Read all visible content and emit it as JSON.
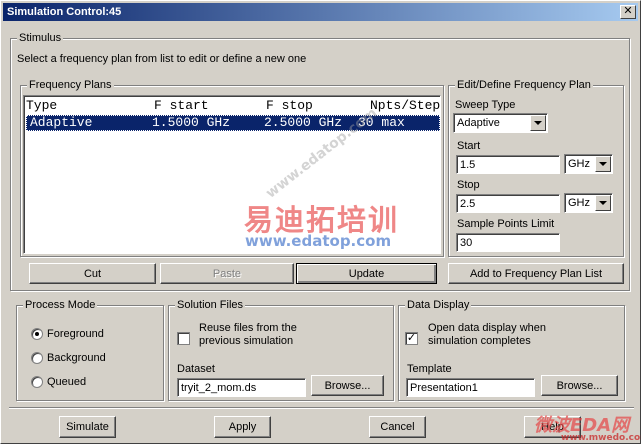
{
  "window": {
    "title": "Simulation Control:45"
  },
  "stimulus": {
    "group_label": "Stimulus",
    "instruction": "Select a frequency plan from list to edit or define a new one"
  },
  "frequency_plans": {
    "group_label": "Frequency Plans",
    "columns": [
      "Type",
      "F start",
      "F stop",
      "Npts/Step"
    ],
    "rows": [
      {
        "type": "Adaptive",
        "fstart": "1.5000 GHz",
        "fstop": "2.5000 GHz",
        "npts": "30 max"
      }
    ],
    "buttons": {
      "cut": "Cut",
      "paste": "Paste",
      "update": "Update"
    }
  },
  "edit_plan": {
    "group_label": "Edit/Define Frequency Plan",
    "sweep_type_label": "Sweep Type",
    "sweep_type_value": "Adaptive",
    "start_label": "Start",
    "start_value": "1.5",
    "start_unit": "GHz",
    "stop_label": "Stop",
    "stop_value": "2.5",
    "stop_unit": "GHz",
    "sample_points_label": "Sample Points Limit",
    "sample_points_value": "30",
    "add_button": "Add to Frequency Plan List"
  },
  "process_mode": {
    "group_label": "Process Mode",
    "options": [
      "Foreground",
      "Background",
      "Queued"
    ],
    "selected": "Foreground"
  },
  "solution_files": {
    "group_label": "Solution Files",
    "reuse_label_line1": "Reuse files from the",
    "reuse_label_line2": "previous simulation",
    "reuse_checked": false,
    "dataset_label": "Dataset",
    "dataset_value": "tryit_2_mom.ds",
    "browse_button": "Browse..."
  },
  "data_display": {
    "group_label": "Data Display",
    "open_label_line1": "Open data display when",
    "open_label_line2": "simulation completes",
    "open_checked": true,
    "template_label": "Template",
    "template_value": "Presentation1",
    "browse_button": "Browse..."
  },
  "footer": {
    "simulate": "Simulate",
    "apply": "Apply",
    "cancel": "Cancel",
    "help": "Help"
  },
  "watermarks": {
    "cn_main": "易迪拓培训",
    "url_main": "www.edatop.com",
    "diagonal": "www.edatop.com",
    "corner_cn": "微波EDA网",
    "corner_url": "www.mwedo.com"
  }
}
